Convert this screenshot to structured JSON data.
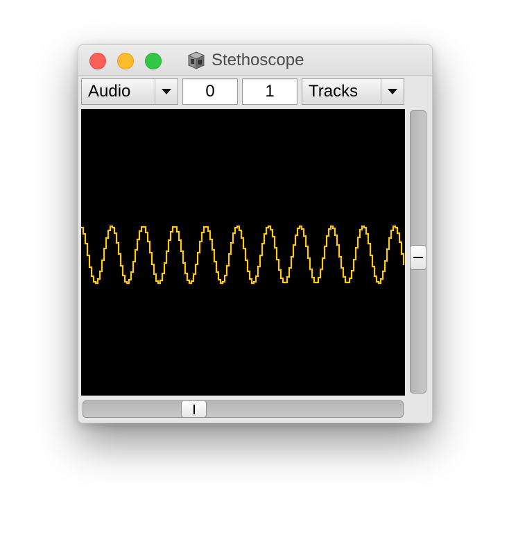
{
  "window": {
    "title": "Stethoscope",
    "title_icon": "document-cube-icon",
    "traffic_lights": {
      "close_color": "#fc5f57",
      "minimize_color": "#fdbc2e",
      "zoom_color": "#33c748"
    }
  },
  "toolbar": {
    "rate_popup": {
      "selected": "Audio",
      "icon": "chevron-down-icon"
    },
    "index_field": {
      "value": "0"
    },
    "channels_field": {
      "value": "1"
    },
    "view_popup": {
      "selected": "Tracks",
      "icon": "chevron-down-icon"
    }
  },
  "scope": {
    "background": "#000000",
    "trace_color": "#ffcc00",
    "waveform": "sine",
    "visible_cycles": 10.3
  },
  "scrollbars": {
    "vertical": {
      "position": 0.52
    },
    "horizontal": {
      "position": 0.33
    }
  }
}
